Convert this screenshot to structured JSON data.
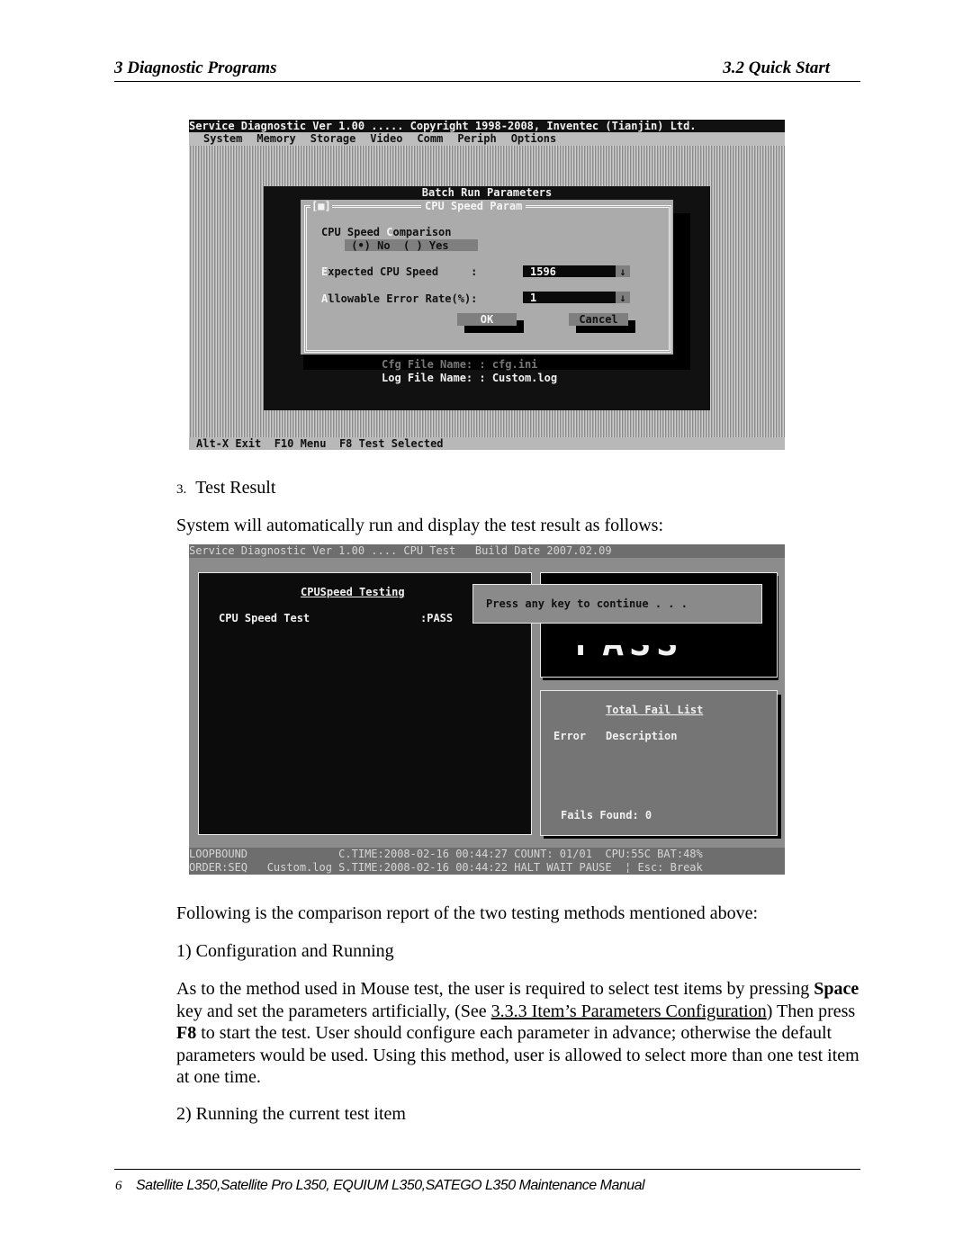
{
  "header": {
    "chapter": "3  Diagnostic Programs",
    "section": "3.2 Quick Start"
  },
  "screen1": {
    "title_bar": "Service Diagnostic Ver 1.00 ..... Copyright 1998-2008, Inventec (Tianjin) Ltd.",
    "menu": [
      "System",
      "Memory",
      "Storage",
      "Video",
      "Comm",
      "Periph",
      "Options"
    ],
    "batch_title": "Batch Run Parameters",
    "dialog": {
      "close_glyph": "[■]",
      "title": "CPU Speed Param",
      "comparison_label_pre": "CPU Speed ",
      "comparison_label_hot": "C",
      "comparison_label_post": "omparison",
      "radio_text": " (•) No  ( ) Yes",
      "radio_selected": "No",
      "expected_hot": "E",
      "expected_label": "xpected CPU Speed     :",
      "expected_value": "1596",
      "error_hot": "A",
      "error_label": "llowable Error Rate(%):",
      "error_value": "1",
      "dropdown_glyph": "↓",
      "ok_label": "OK",
      "cancel_label": "Cancel"
    },
    "cfg_file": "Cfg File Name: : cfg.ini",
    "log_file": "Log File Name: : Custom.log",
    "status_bar": "Alt-X Exit  F10 Menu  F8 Test Selected"
  },
  "step": {
    "number": "3.",
    "title": "Test Result"
  },
  "intro_text": "System will automatically run and display the test result as follows:",
  "screen2": {
    "title_bar": "Service Diagnostic Ver 1.00 .... CPU Test   Build Date 2007.02.09",
    "panel_heading": "CPUSpeed Testing",
    "test_name": "CPU Speed Test",
    "test_result": ":PASS",
    "big_result": "PASS",
    "popup_text": "Press any key to continue . . .",
    "fail_list": {
      "heading": "Total Fail List",
      "col_error": "Error",
      "col_description": "Description",
      "fails_found": "Fails Found: 0"
    },
    "status_line1": "LOOPBOUND              C.TIME:2008-02-16 00:44:27 COUNT: 01/01  CPU:55C BAT:48%",
    "status_line2": "ORDER:SEQ   Custom.log S.TIME:2008-02-16 00:44:22 HALT WAIT PAUSE  ¦ Esc: Break"
  },
  "comparison_intro": "Following is the comparison report of the two testing methods mentioned above:",
  "item1": "1) Configuration and Running",
  "paragraph": {
    "p1": "As to the method used in Mouse test, the user is required to select test items by pressing ",
    "bold1": "Space",
    "p2": " key and set the parameters artificially, (See ",
    "link": "3.3.3 Item’s Parameters Configuration",
    "p3": ") Then press ",
    "bold2": "F8",
    "p4": " to start the test. User should configure each parameter in advance; otherwise the default parameters would be used. Using this method, user is allowed to select more than one test item at one time."
  },
  "item2": "2) Running the current test item",
  "footer": {
    "page_number": "6",
    "manual_title": "Satellite L350,Satellite Pro L350, EQUIUM L350,SATEGO L350 Maintenance Manual"
  }
}
